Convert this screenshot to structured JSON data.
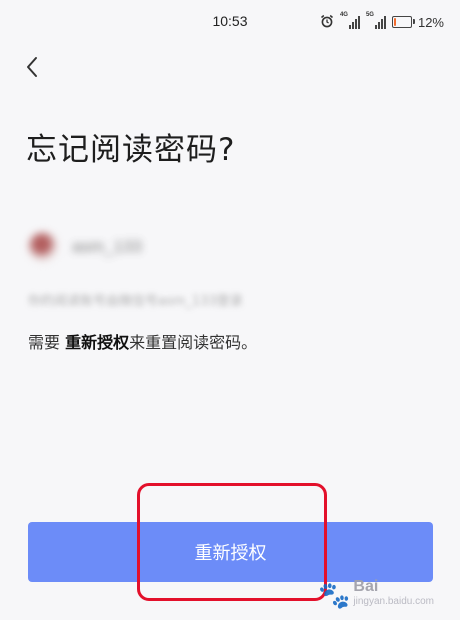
{
  "status_bar": {
    "time": "10:53",
    "network_1": "4G",
    "network_2": "5G",
    "battery_text": "12%",
    "battery_level": 0.12,
    "alarm_icon": "alarm-icon"
  },
  "header": {
    "back_icon": "chevron-left-icon"
  },
  "title": "忘记阅读密码?",
  "account": {
    "name": "asm_133",
    "note": "你的阅读账号由微信号asm_133登录"
  },
  "instruction": {
    "prefix": "需要 ",
    "emphasis": "重新授权",
    "suffix": "来重置阅读密码。"
  },
  "primary_button": {
    "label": "重新授权"
  },
  "watermark": {
    "big": "Bai",
    "paw": "🐾",
    "small": "jingyan.baidu.com"
  },
  "colors": {
    "accent": "#6c8cf8",
    "highlight": "#e3102b",
    "background": "#f7f7f9"
  }
}
